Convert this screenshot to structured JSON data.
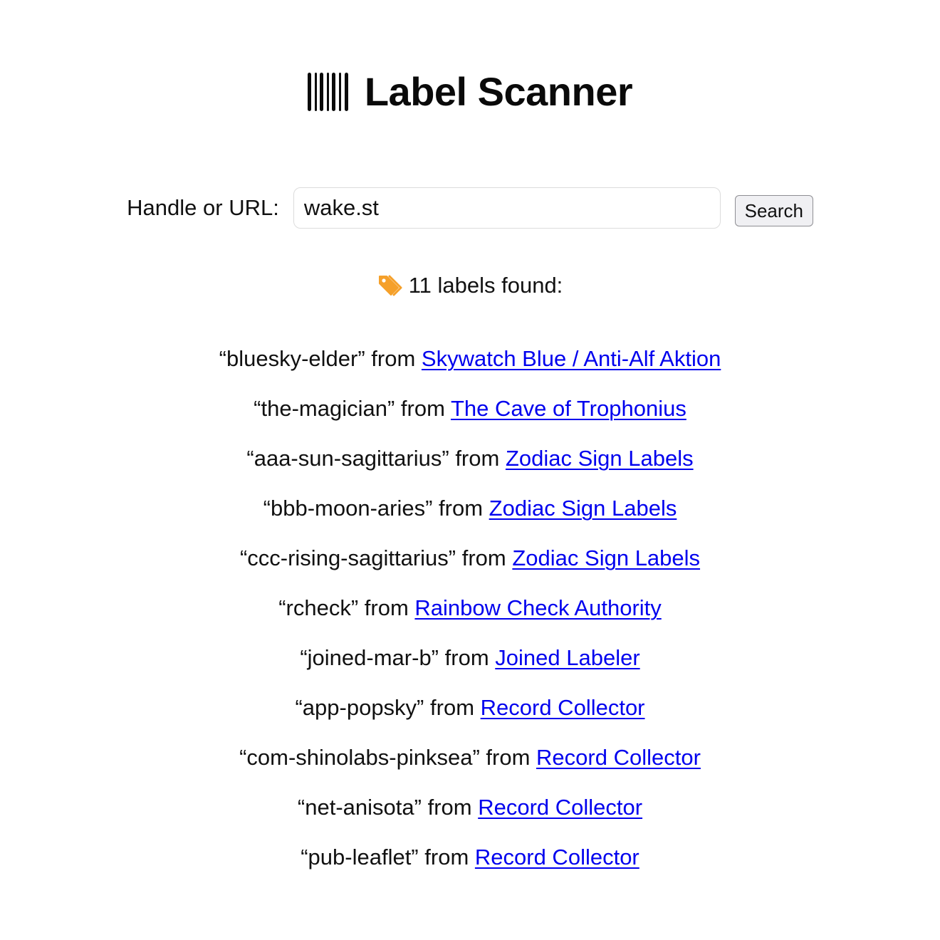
{
  "header": {
    "icon": "barcode-icon",
    "title": "Label Scanner"
  },
  "search": {
    "label": "Handle or URL:",
    "value": "wake.st",
    "placeholder": "",
    "button_label": "Search"
  },
  "results": {
    "icon": "tag-icon",
    "icon_color": "#f5a02a",
    "summary": "11 labels found:",
    "link_color": "#0000ee",
    "from_word": "from",
    "items": [
      {
        "label": "“bluesky-elder”",
        "labeler": "Skywatch Blue / Anti-Alf Aktion"
      },
      {
        "label": "“the-magician”",
        "labeler": "The Cave of Trophonius"
      },
      {
        "label": "“aaa-sun-sagittarius”",
        "labeler": "Zodiac Sign Labels"
      },
      {
        "label": "“bbb-moon-aries”",
        "labeler": "Zodiac Sign Labels"
      },
      {
        "label": "“ccc-rising-sagittarius”",
        "labeler": "Zodiac Sign Labels"
      },
      {
        "label": "“rcheck”",
        "labeler": "Rainbow Check Authority"
      },
      {
        "label": "“joined-mar-b”",
        "labeler": "Joined Labeler"
      },
      {
        "label": "“app-popsky”",
        "labeler": "Record Collector"
      },
      {
        "label": "“com-shinolabs-pinksea”",
        "labeler": "Record Collector"
      },
      {
        "label": "“net-anisota”",
        "labeler": "Record Collector"
      },
      {
        "label": "“pub-leaflet”",
        "labeler": "Record Collector"
      }
    ]
  }
}
